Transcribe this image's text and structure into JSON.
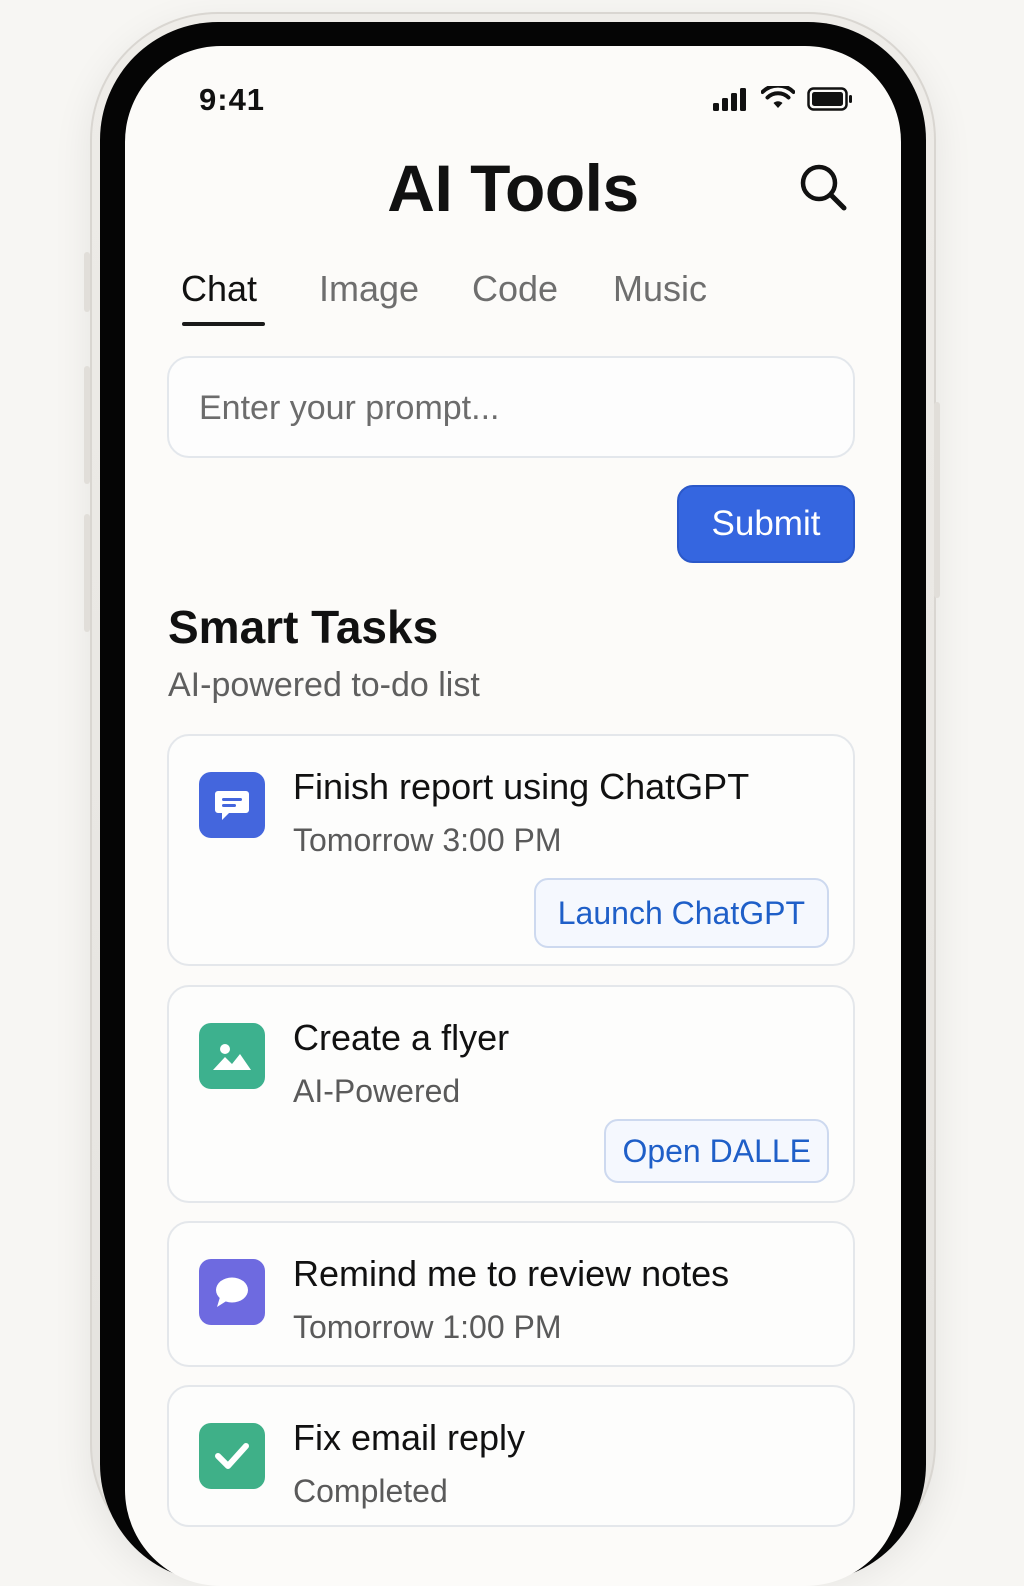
{
  "status_bar": {
    "time": "9:41",
    "icons": [
      "signal-icon",
      "wifi-icon",
      "battery-icon"
    ]
  },
  "header": {
    "title": "AI Tools",
    "search_icon": "search-icon"
  },
  "tabs": [
    {
      "label": "Chat",
      "active": true
    },
    {
      "label": "Image",
      "active": false
    },
    {
      "label": "Code",
      "active": false
    },
    {
      "label": "Music",
      "active": false
    }
  ],
  "prompt": {
    "placeholder": "Enter your prompt...",
    "value": "",
    "submit_label": "Submit"
  },
  "section": {
    "title": "Smart Tasks",
    "subtitle": "AI-powered to-do list"
  },
  "tasks": [
    {
      "title": "Finish report using ChatGPT",
      "meta": "Tomorrow 3:00 PM",
      "action": "Launch ChatGPT",
      "icon": "chat-icon",
      "icon_color": "#4466dd"
    },
    {
      "title": "Create a flyer",
      "meta": "AI-Powered",
      "action": "Open DALLE",
      "icon": "image-icon",
      "icon_color": "#3db18e"
    },
    {
      "title": "Remind me to review notes",
      "meta": "Tomorrow 1:00 PM",
      "action": "",
      "icon": "speech-bubble-icon",
      "icon_color": "#6e6ae0"
    },
    {
      "title": "Fix email reply",
      "meta": "Completed",
      "action": "",
      "icon": "check-icon",
      "icon_color": "#3fb088"
    }
  ],
  "colors": {
    "accent": "#3566e0",
    "link": "#1f5fc8",
    "background": "#fcfbf9"
  }
}
